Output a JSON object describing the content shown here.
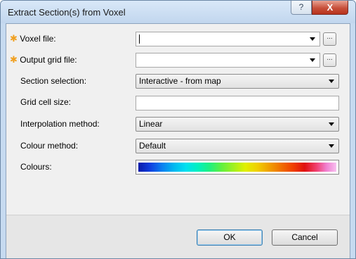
{
  "window": {
    "title": "Extract Section(s) from Voxel",
    "help_glyph": "?",
    "close_glyph": "X"
  },
  "form": {
    "required_marker": "✱",
    "voxel_file": {
      "label": "Voxel file:",
      "value": "",
      "browse_label": "..."
    },
    "output_grid_file": {
      "label": "Output grid file:",
      "value": "",
      "browse_label": "..."
    },
    "section_selection": {
      "label": "Section selection:",
      "value": "Interactive - from map"
    },
    "grid_cell_size": {
      "label": "Grid cell size:",
      "value": ""
    },
    "interpolation_method": {
      "label": "Interpolation method:",
      "value": "Linear"
    },
    "colour_method": {
      "label": "Colour method:",
      "value": "Default"
    },
    "colours": {
      "label": "Colours:"
    }
  },
  "buttons": {
    "ok": "OK",
    "cancel": "Cancel"
  }
}
